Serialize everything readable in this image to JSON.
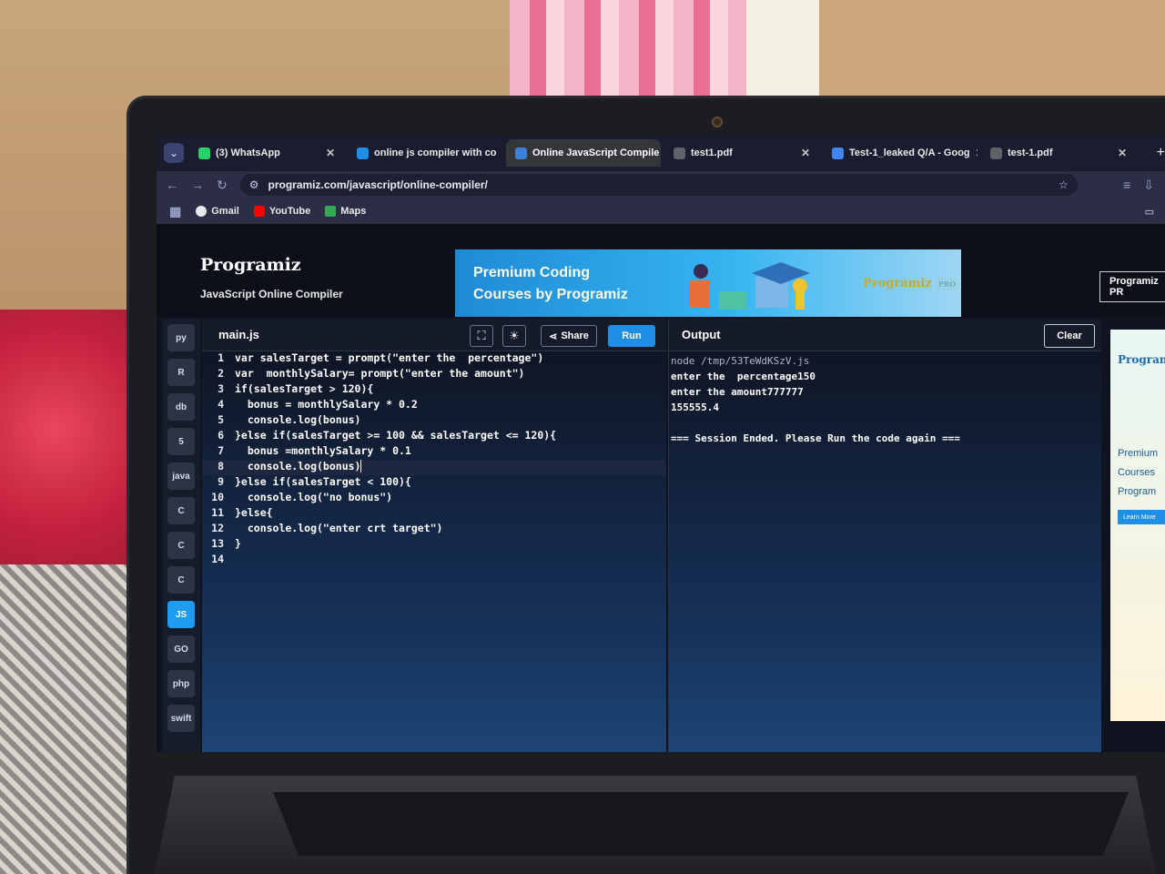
{
  "browser": {
    "tabs": [
      {
        "title": "(3) WhatsApp",
        "color": "#25d366"
      },
      {
        "title": "online js compiler with co",
        "color": "#1f8fe6"
      },
      {
        "title": "Online JavaScript Compile",
        "color": "#3f7fd8",
        "active": true
      },
      {
        "title": "test1.pdf",
        "color": "#5f6368"
      },
      {
        "title": "Test-1_leaked Q/A - Goog",
        "color": "#4285f4"
      },
      {
        "title": "test-1.pdf",
        "color": "#5f6368"
      }
    ],
    "url": "programiz.com/javascript/online-compiler/",
    "bookmarks": [
      "Gmail",
      "YouTube",
      "Maps"
    ]
  },
  "page": {
    "logo": "Programiz",
    "subtitle": "JavaScript Online Compiler",
    "banner_line1": "Premium Coding",
    "banner_line2": "Courses by Programiz",
    "banner_brand": "Programiz",
    "banner_pro": "PRO",
    "pro_button": "Programiz PR",
    "side_ad_brand": "Program",
    "side_ad_line1": "Premium",
    "side_ad_line2": "Courses",
    "side_ad_line3": "Program",
    "side_ad_button": "Learn More"
  },
  "rail": [
    "py",
    "R",
    "db",
    "5",
    "java",
    "C",
    "C",
    "C",
    "JS",
    "GO",
    "php",
    "swift"
  ],
  "editor": {
    "filename": "main.js",
    "share_label": "Share",
    "run_label": "Run",
    "lines": [
      {
        "n": "1",
        "code": "var salesTarget = prompt(\"enter the  percentage\")"
      },
      {
        "n": "2",
        "code": "var  monthlySalary= prompt(\"enter the amount\")"
      },
      {
        "n": "3",
        "code": "if(salesTarget > 120){"
      },
      {
        "n": "4",
        "code": "  bonus = monthlySalary * 0.2"
      },
      {
        "n": "5",
        "code": "  console.log(bonus)"
      },
      {
        "n": "6",
        "code": "}else if(salesTarget >= 100 && salesTarget <= 120){"
      },
      {
        "n": "7",
        "code": "  bonus =monthlySalary * 0.1"
      },
      {
        "n": "8",
        "code": "  console.log(bonus)",
        "current": true
      },
      {
        "n": "9",
        "code": "}else if(salesTarget < 100){"
      },
      {
        "n": "10",
        "code": "  console.log(\"no bonus\")"
      },
      {
        "n": "11",
        "code": "}else{"
      },
      {
        "n": "12",
        "code": "  console.log(\"enter crt target\")"
      },
      {
        "n": "13",
        "code": "}"
      },
      {
        "n": "14",
        "code": ""
      }
    ]
  },
  "output": {
    "title": "Output",
    "clear_label": "Clear",
    "lines": [
      {
        "text": "node /tmp/53TeWdKSzV.js",
        "dim": true
      },
      {
        "text": "enter the  percentage150"
      },
      {
        "text": "enter the amount777777"
      },
      {
        "text": "155555.4"
      },
      {
        "text": ""
      },
      {
        "text": "=== Session Ended. Please Run the code again ==="
      }
    ]
  }
}
